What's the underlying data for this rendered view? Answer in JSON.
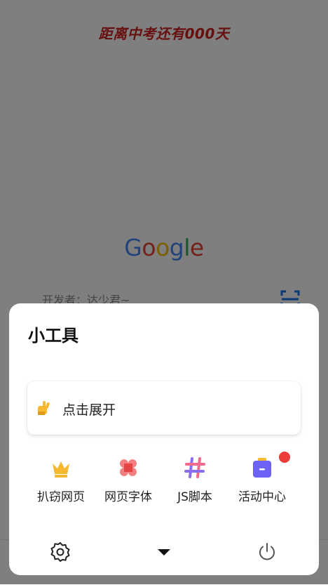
{
  "page": {
    "countdown_text": "距离中考还有000天",
    "logo_letters": [
      {
        "ch": "G",
        "color": "#4285F4"
      },
      {
        "ch": "o",
        "color": "#EA4335"
      },
      {
        "ch": "o",
        "color": "#FBBC05"
      },
      {
        "ch": "g",
        "color": "#4285F4"
      },
      {
        "ch": "l",
        "color": "#34A853"
      },
      {
        "ch": "e",
        "color": "#EA4335"
      }
    ],
    "search_hint": "开发者：达少君~",
    "scan_icon": "scan-icon"
  },
  "sheet": {
    "title": "小工具",
    "expand": {
      "icon": "hand-point-icon",
      "label": "点击展开"
    },
    "tools": [
      {
        "label": "扒窃网页",
        "icon": "crown-icon",
        "color": "#F5B82E"
      },
      {
        "label": "网页字体",
        "icon": "flower-grid-icon",
        "color": "#F26B6B"
      },
      {
        "label": "JS脚本",
        "icon": "hash-icon",
        "color": "#8A6BF2"
      },
      {
        "label": "活动中心",
        "icon": "bag-icon",
        "color": "#6C63F6",
        "badge": true
      }
    ],
    "footer": {
      "left_icon": "gear-icon",
      "center_icon": "caret-down-icon",
      "right_icon": "power-icon"
    }
  },
  "colors": {
    "overlay": "rgba(0,0,0,0.5)",
    "accent_red": "#d11f1f",
    "badge_red": "#ee3a38"
  }
}
